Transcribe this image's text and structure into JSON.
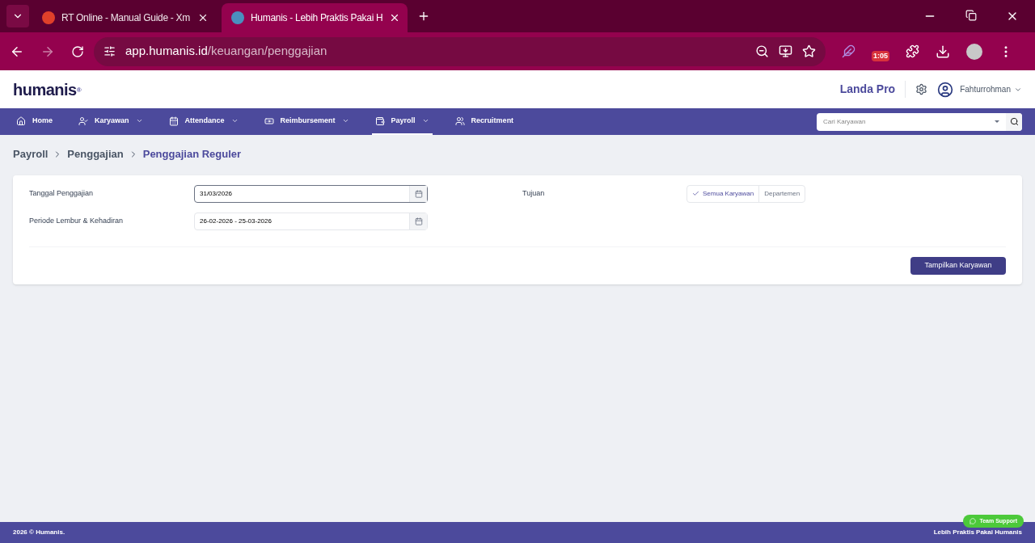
{
  "browser": {
    "tabs": [
      {
        "title": "RT Online - Manual Guide - Xm",
        "selected": false
      },
      {
        "title": "Humanis - Lebih Praktis Pakai H",
        "selected": true
      }
    ],
    "url_host": "app.humanis.id",
    "url_path": "/keuangan/penggajian",
    "extension_badge": "1:05"
  },
  "header": {
    "logo": "humanis",
    "logo_mark": "®",
    "company": "Landa Pro",
    "user": "Fahturrohman"
  },
  "nav": {
    "items": [
      {
        "label": "Home",
        "dropdown": false,
        "selected": false
      },
      {
        "label": "Karyawan",
        "dropdown": true,
        "selected": false
      },
      {
        "label": "Attendance",
        "dropdown": true,
        "selected": false
      },
      {
        "label": "Reimbursement",
        "dropdown": true,
        "selected": false
      },
      {
        "label": "Payroll",
        "dropdown": true,
        "selected": true
      },
      {
        "label": "Recruitment",
        "dropdown": false,
        "selected": false
      }
    ],
    "search": {
      "placeholder": "Cari Karyawan"
    }
  },
  "breadcrumb": [
    "Payroll",
    "Penggajian",
    "Penggajian Reguler"
  ],
  "form": {
    "fields": [
      {
        "label": "Tanggal Penggajian",
        "value": "31/03/2026",
        "focused": true
      },
      {
        "label": "Periode Lembur & Kehadiran",
        "value": "26-02-2026 - 25-03-2026",
        "focused": false
      }
    ],
    "target_label": "Tujuan",
    "target_options": [
      {
        "label": "Semua Karyawan",
        "selected": true
      },
      {
        "label": "Departemen",
        "selected": false
      }
    ],
    "submit": "Tampilkan Karyawan"
  },
  "footer": {
    "left": "2026 © Humanis.",
    "right": "Lebih Praktis Pakai Humanis",
    "support": "Team Support"
  }
}
